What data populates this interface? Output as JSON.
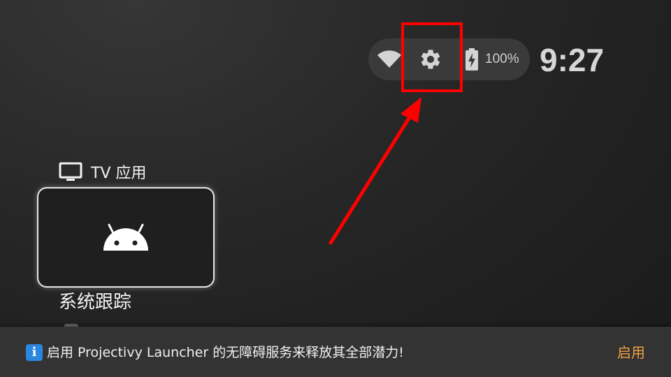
{
  "status_bar": {
    "icons": {
      "wifi": "wifi-icon",
      "settings": "gear-icon",
      "battery": "battery-charging-icon"
    },
    "battery_percent": "100%",
    "clock": "9:27"
  },
  "section": {
    "icon": "tv-icon",
    "title": "TV 应用"
  },
  "app_card": {
    "icon": "android-icon",
    "label": "系统跟踪"
  },
  "snackbar": {
    "icon_glyph": "i",
    "message": "启用 Projectivy Launcher 的无障碍服务来释放其全部潜力!",
    "action_label": "启用"
  },
  "annotation": {
    "highlight_color": "#ff0000"
  },
  "colors": {
    "accent": "#f0a040",
    "info_blue": "#2b86e0"
  }
}
